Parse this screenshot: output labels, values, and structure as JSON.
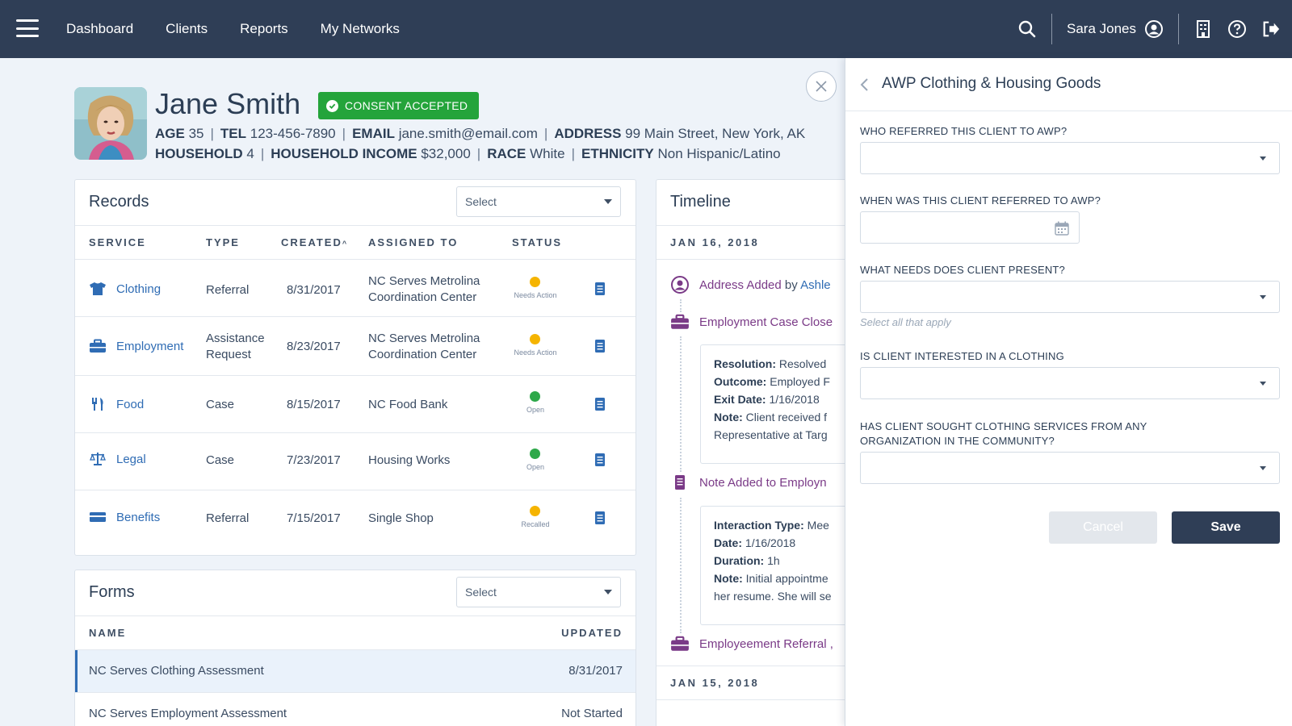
{
  "nav": {
    "items": [
      "Dashboard",
      "Clients",
      "Reports",
      "My Networks"
    ],
    "user_name": "Sara Jones"
  },
  "client": {
    "name": "Jane Smith",
    "consent_label": "CONSENT ACCEPTED",
    "age_label": "AGE",
    "age": "35",
    "tel_label": "TEL",
    "tel": "123-456-7890",
    "email_label": "EMAIL",
    "email": "jane.smith@email.com",
    "address_label": "ADDRESS",
    "address": "99 Main Street, New York, AK",
    "household_label": "HOUSEHOLD",
    "household": "4",
    "income_label": "HOUSEHOLD INCOME",
    "income": "$32,000",
    "race_label": "RACE",
    "race": "White",
    "ethnicity_label": "ETHNICITY",
    "ethnicity": "Non Hispanic/Latino"
  },
  "records": {
    "title": "Records",
    "select_placeholder": "Select",
    "headers": [
      "SERVICE",
      "TYPE",
      "CREATED",
      "ASSIGNED TO",
      "STATUS"
    ],
    "rows": [
      {
        "service": "Clothing",
        "icon": "shirt-icon",
        "type": [
          "Referral"
        ],
        "created": "8/31/2017",
        "assigned": [
          "NC Serves Metrolina",
          "Coordination Center"
        ],
        "status": "Needs Action",
        "status_color": "#f5b400"
      },
      {
        "service": "Employment",
        "icon": "briefcase-icon",
        "type": [
          "Assistance",
          "Request"
        ],
        "created": "8/23/2017",
        "assigned": [
          "NC Serves Metrolina",
          "Coordination Center"
        ],
        "status": "Needs Action",
        "status_color": "#f5b400"
      },
      {
        "service": "Food",
        "icon": "utensils-icon",
        "type": [
          "Case"
        ],
        "created": "8/15/2017",
        "assigned": [
          "NC Food Bank"
        ],
        "status": "Open",
        "status_color": "#2ea84a"
      },
      {
        "service": "Legal",
        "icon": "scales-icon",
        "type": [
          "Case"
        ],
        "created": "7/23/2017",
        "assigned": [
          "Housing Works"
        ],
        "status": "Open",
        "status_color": "#2ea84a"
      },
      {
        "service": "Benefits",
        "icon": "card-icon",
        "type": [
          "Referral"
        ],
        "created": "7/15/2017",
        "assigned": [
          "Single Shop"
        ],
        "status": "Recalled",
        "status_color": "#f5b400"
      }
    ]
  },
  "forms": {
    "title": "Forms",
    "select_placeholder": "Select",
    "headers": [
      "NAME",
      "UPDATED"
    ],
    "rows": [
      {
        "name": "NC Serves Clothing Assessment",
        "updated": "8/31/2017"
      },
      {
        "name": "NC Serves Employment Assessment",
        "updated": "Not Started"
      }
    ]
  },
  "timeline": {
    "title": "Timeline",
    "date1": "JAN 16, 2018",
    "event1_main": "Address Added",
    "event1_by": "by",
    "event1_who": "Ashle",
    "event2": "Employment Case Close",
    "box1": [
      {
        "label": "Resolution:",
        "value": "Resolved"
      },
      {
        "label": "Outcome:",
        "value": "Employed F"
      },
      {
        "label": "Exit Date:",
        "value": "1/16/2018"
      },
      {
        "label": "Note:",
        "value": "Client received f"
      },
      {
        "label": "",
        "value": "Representative at Targ"
      }
    ],
    "event3": "Note Added to Employn",
    "box2": [
      {
        "label": "Interaction Type:",
        "value": "Mee"
      },
      {
        "label": "Date:",
        "value": "1/16/2018"
      },
      {
        "label": "Duration:",
        "value": "1h"
      },
      {
        "label": "Note:",
        "value": "Initial appointme"
      },
      {
        "label": "",
        "value": "her resume. She will se"
      }
    ],
    "event4": "Employeement Referral ,",
    "date2": "JAN 15, 2018"
  },
  "panel": {
    "title": "AWP Clothing & Housing Goods",
    "q1": "WHO REFERRED THIS CLIENT TO AWP?",
    "q2": "WHEN WAS THIS CLIENT REFERRED TO AWP?",
    "q3": "WHAT NEEDS DOES CLIENT PRESENT?",
    "q3_hint": "Select all that apply",
    "q4": "IS CLIENT INTERESTED IN A CLOTHING",
    "q5_line1": "HAS CLIENT SOUGHT CLOTHING SERVICES FROM ANY",
    "q5_line2": "ORGANIZATION IN THE COMMUNITY?",
    "cancel_label": "Cancel",
    "save_label": "Save"
  },
  "colors": {
    "topbar": "#2f3e56",
    "consent": "#24a43b",
    "link": "#2f6cb4",
    "timeline_accent": "#7a3a87",
    "needs_action": "#f5b400",
    "open": "#2ea84a"
  }
}
